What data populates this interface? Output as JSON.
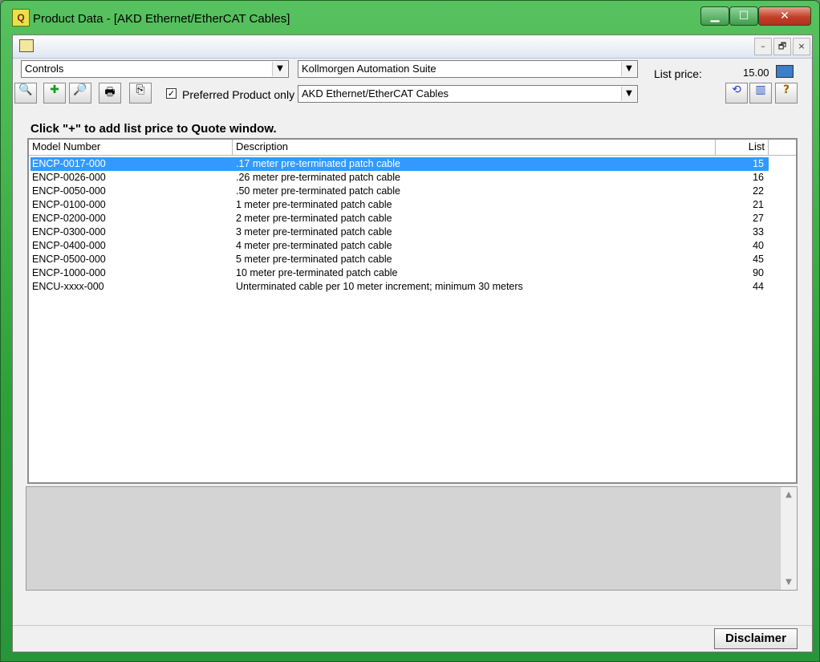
{
  "window": {
    "title": "Product Data - [AKD Ethernet/EtherCAT Cables]",
    "app_icon_glyph": "Q",
    "caption_buttons": {
      "minimize": "▁",
      "maximize": "☐",
      "close": "✕"
    }
  },
  "mdi": {
    "minimize": "–",
    "restore": "🗗",
    "close": "×"
  },
  "filters": {
    "category": "Controls",
    "suite": "Kollmorgen Automation Suite",
    "list_price_label": "List price:",
    "list_price_value": "15.00",
    "product_line": "AKD Ethernet/EtherCAT Cables",
    "preferred_label": "Preferred Product only",
    "preferred_checked": true
  },
  "toolbar": {
    "find_glyph": "🔍",
    "add_glyph": "✚",
    "zoom_glyph": "🔎",
    "print_glyph": "🖶",
    "export_glyph": "⎘",
    "refresh_glyph": "⟲",
    "book_glyph": "▥",
    "help_glyph": "?"
  },
  "hint": "Click \"+\" to add list price to Quote window.",
  "table": {
    "columns": [
      "Model Number",
      "Description",
      "List"
    ],
    "rows": [
      {
        "model": "ENCP-0017-000",
        "desc": ".17 meter pre-terminated patch cable",
        "list": "15",
        "selected": true
      },
      {
        "model": "ENCP-0026-000",
        "desc": ".26 meter pre-terminated patch cable",
        "list": "16"
      },
      {
        "model": "ENCP-0050-000",
        "desc": ".50 meter pre-terminated patch cable",
        "list": "22"
      },
      {
        "model": "ENCP-0100-000",
        "desc": "1 meter pre-terminated patch cable",
        "list": "21"
      },
      {
        "model": "ENCP-0200-000",
        "desc": "2 meter pre-terminated patch cable",
        "list": "27"
      },
      {
        "model": "ENCP-0300-000",
        "desc": "3 meter pre-terminated patch cable",
        "list": "33"
      },
      {
        "model": "ENCP-0400-000",
        "desc": "4 meter pre-terminated patch cable",
        "list": "40"
      },
      {
        "model": "ENCP-0500-000",
        "desc": "5 meter pre-terminated patch cable",
        "list": "45"
      },
      {
        "model": "ENCP-1000-000",
        "desc": "10 meter pre-terminated patch cable",
        "list": "90"
      },
      {
        "model": "ENCU-xxxx-000",
        "desc": "Unterminated cable per 10 meter increment; minimum 30 meters",
        "list": "44"
      }
    ]
  },
  "scroll": {
    "up": "▲",
    "down": "▼"
  },
  "dropdown_arrow": "▼",
  "disclaimer_label": "Disclaimer",
  "colors": {
    "selection": "#3399ff",
    "title_bar": "#2ea039"
  }
}
